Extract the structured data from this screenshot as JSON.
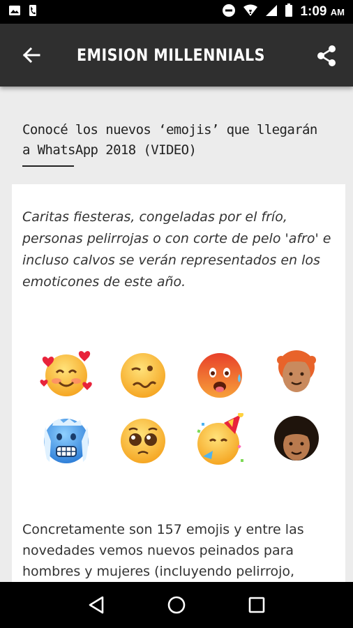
{
  "status_bar": {
    "time": "1:09",
    "ampm": "AM",
    "icons": [
      "image-icon",
      "phone-icon",
      "do-not-disturb-icon",
      "wifi-icon",
      "signal-icon",
      "battery-icon"
    ]
  },
  "app_bar": {
    "title": "EMISION MILLENNIALS",
    "back_icon": "arrow-back-icon",
    "share_icon": "share-icon"
  },
  "article": {
    "headline": "Conocé los nuevos ‘emojis’ que llegarán a WhatsApp 2018 (VIDEO)",
    "lead": "Caritas fiesteras, congeladas por el frío, personas pelirrojas o con corte de pelo 'afro' e incluso calvos se verán representados en los emoticones de este año.",
    "emojis": [
      "smiling-face-with-hearts",
      "woozy-face",
      "hot-face",
      "person-red-hair",
      "cold-face",
      "pleading-face",
      "partying-face",
      "person-curly-hair"
    ],
    "body": "Concretamente son 157 emojis y entre las novedades vemos nuevos peinados para hombres y mujeres (incluyendo pelirrojo,"
  },
  "nav_bar": {
    "icons": [
      "back-triangle-icon",
      "home-circle-icon",
      "recents-square-icon"
    ]
  },
  "colors": {
    "app_bar": "#2f2f2f",
    "status_bar": "#000000",
    "background": "#ececec",
    "card": "#ffffff"
  }
}
